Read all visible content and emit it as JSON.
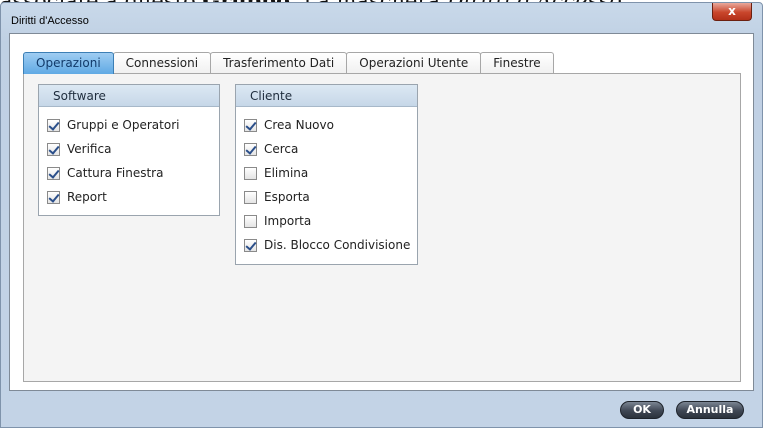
{
  "doc": {
    "text_1": "associate a questo ",
    "text_bold": "Gruppo",
    "text_2": ". La maschera ",
    "text_italic": "Diritti d'Accesso"
  },
  "window": {
    "title": "Diritti d'Accesso",
    "close_glyph": "x"
  },
  "tabs": [
    {
      "label": "Operazioni",
      "active": true
    },
    {
      "label": "Connessioni",
      "active": false
    },
    {
      "label": "Trasferimento Dati",
      "active": false
    },
    {
      "label": "Operazioni Utente",
      "active": false
    },
    {
      "label": "Finestre",
      "active": false
    }
  ],
  "software": {
    "title": "Software",
    "items": [
      {
        "label": "Gruppi e Operatori",
        "checked": true
      },
      {
        "label": "Verifica",
        "checked": true
      },
      {
        "label": "Cattura Finestra",
        "checked": true
      },
      {
        "label": "Report",
        "checked": true
      }
    ]
  },
  "cliente": {
    "title": "Cliente",
    "items": [
      {
        "label": "Crea Nuovo",
        "checked": true
      },
      {
        "label": "Cerca",
        "checked": true
      },
      {
        "label": "Elimina",
        "checked": false
      },
      {
        "label": "Esporta",
        "checked": false
      },
      {
        "label": "Importa",
        "checked": false
      },
      {
        "label": "Dis. Blocco Condivisione",
        "checked": true
      }
    ]
  },
  "buttons": {
    "ok": "OK",
    "cancel": "Annulla"
  },
  "colors": {
    "active_tab": "#5fa9e4",
    "window_bg": "#c3d3e6",
    "close_button": "#c9462c"
  }
}
